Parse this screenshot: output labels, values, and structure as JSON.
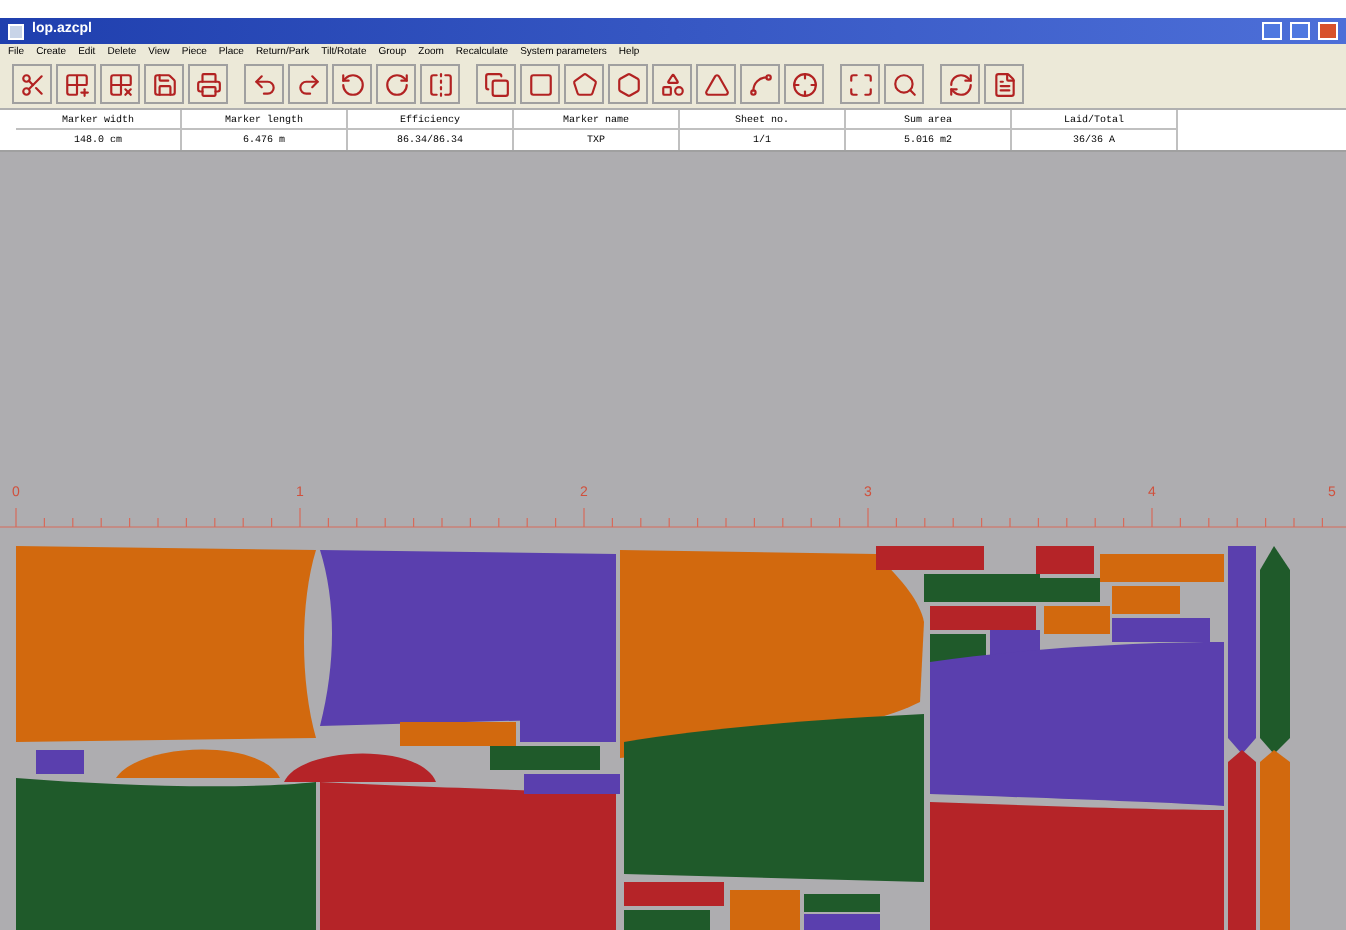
{
  "window": {
    "title": "lop.azcpl"
  },
  "menu": [
    "File",
    "Create",
    "Edit",
    "Delete",
    "View",
    "Piece",
    "Place",
    "Return/Park",
    "Tilt/Rotate",
    "Group",
    "Zoom",
    "Recalculate",
    "System parameters",
    "Help"
  ],
  "info": [
    {
      "label": "Marker width",
      "value": "148.0 cm"
    },
    {
      "label": "Marker length",
      "value": "6.476 m"
    },
    {
      "label": "Efficiency",
      "value": "86.34/86.34"
    },
    {
      "label": "Marker name",
      "value": "TXP"
    },
    {
      "label": "Sheet no.",
      "value": "1/1"
    },
    {
      "label": "Sum area",
      "value": "5.016 m2"
    },
    {
      "label": "Laid/Total",
      "value": "36/36 A"
    }
  ],
  "ruler": {
    "labels": [
      "0",
      "1",
      "2",
      "3",
      "4",
      "5"
    ]
  }
}
